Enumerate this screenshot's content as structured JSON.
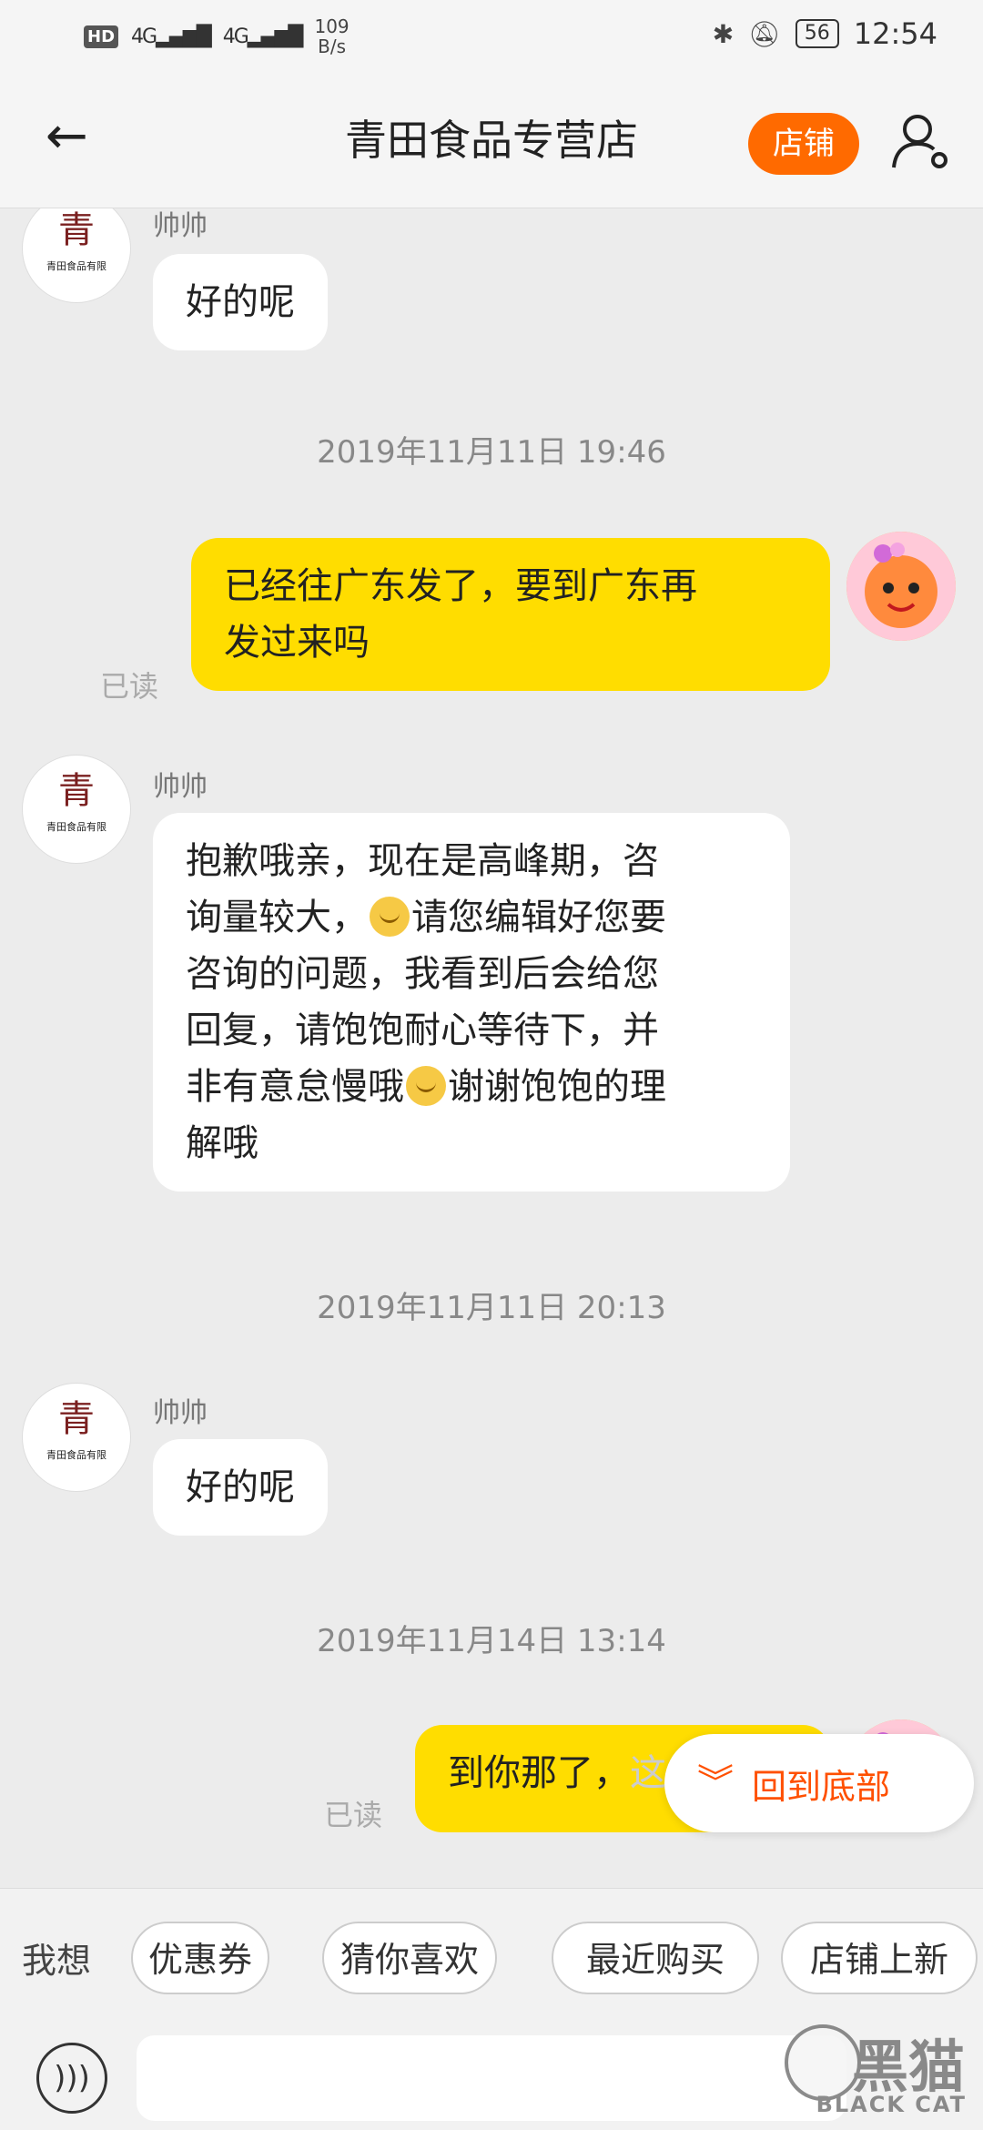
{
  "status_bar": {
    "hd": "HD",
    "sim1_signal": "4G",
    "sim2_signal": "4G",
    "speed_value": "109",
    "speed_unit": "B/s",
    "battery": "56",
    "time": "12:54"
  },
  "header": {
    "title": "青田食品专营店",
    "shop_button": "店铺"
  },
  "messages": [
    {
      "type": "left",
      "sender": "帅帅",
      "text": "好的呢"
    },
    {
      "type": "timestamp",
      "text": "2019年11月11日 19:46"
    },
    {
      "type": "right",
      "text_lines": [
        "已经往广东发了，要到广东再",
        "发过来吗"
      ],
      "status": "已读"
    },
    {
      "type": "left",
      "sender": "帅帅",
      "text_lines": [
        "抱歉哦亲，现在是高峰期，咨",
        "询量较大，",
        "请您编辑好您要",
        "咨询的问题，我看到后会给您",
        "回复，请饱饱耐心等待下，并",
        "非有意怠慢哦",
        "谢谢饱饱的理",
        "解哦"
      ]
    },
    {
      "type": "timestamp",
      "text": "2019年11月11日 20:13"
    },
    {
      "type": "left",
      "sender": "帅帅",
      "text": "好的呢"
    },
    {
      "type": "timestamp",
      "text": "2019年11月14日 13:14"
    },
    {
      "type": "right",
      "text": "到你那了，",
      "text_hidden_tail": "这件衣",
      "status": "已读"
    }
  ],
  "floating_button": {
    "label": "回到底部"
  },
  "quick_bar": {
    "label": "我想",
    "chips": [
      "优惠券",
      "猜你喜欢",
      "最近购买",
      "店铺上新"
    ]
  },
  "watermark": {
    "cn": "黑猫",
    "en": "BLACK CAT"
  },
  "colors": {
    "accent": "#ff6a00",
    "my_bubble": "#ffdd00",
    "link": "#ff5000"
  }
}
